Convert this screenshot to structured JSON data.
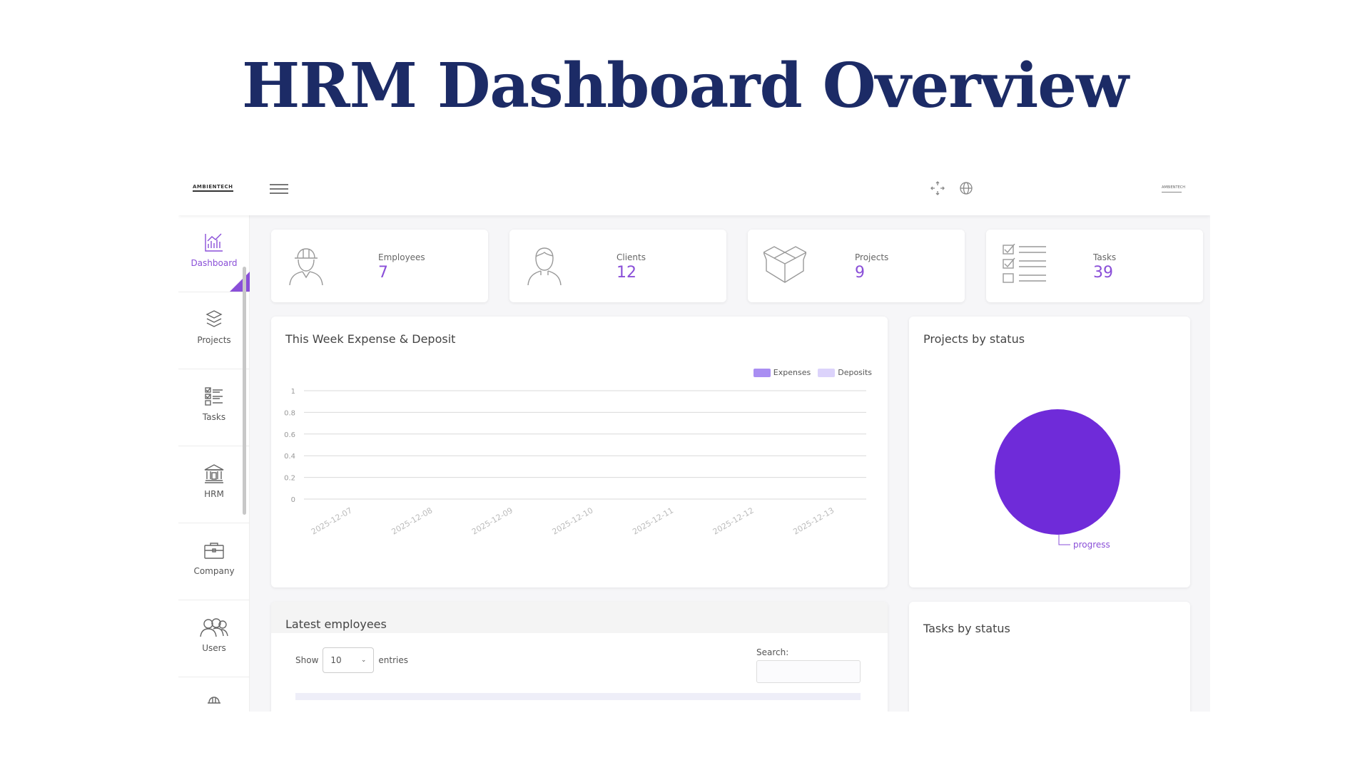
{
  "page": {
    "title": "HRM Dashboard Overview"
  },
  "topbar": {
    "logo": "AMBIENTECH",
    "avatar_text": "AMBIENTECH"
  },
  "sidebar": {
    "items": [
      {
        "label": "Dashboard",
        "icon": "chart-icon",
        "active": true
      },
      {
        "label": "Projects",
        "icon": "boxes-icon"
      },
      {
        "label": "Tasks",
        "icon": "checklist-icon"
      },
      {
        "label": "HRM",
        "icon": "bank-icon"
      },
      {
        "label": "Company",
        "icon": "briefcase-icon"
      },
      {
        "label": "Users",
        "icon": "users-icon"
      }
    ]
  },
  "stats": [
    {
      "label": "Employees",
      "value": "7",
      "icon": "worker-icon"
    },
    {
      "label": "Clients",
      "value": "12",
      "icon": "client-icon"
    },
    {
      "label": "Projects",
      "value": "9",
      "icon": "boxes-icon"
    },
    {
      "label": "Tasks",
      "value": "39",
      "icon": "checklist-icon"
    }
  ],
  "expense_card": {
    "title": "This Week Expense & Deposit"
  },
  "projects_card": {
    "title": "Projects by status"
  },
  "tasks_card": {
    "title": "Tasks by status"
  },
  "employees_card": {
    "title": "Latest employees",
    "show_label": "Show",
    "entries_value": "10",
    "entries_label": "entries",
    "search_label": "Search:"
  },
  "colors": {
    "accent": "#8a4fd8",
    "expenses": "#a98ef2",
    "deposits": "#dcd3fb",
    "pie": "#6f2bd9"
  },
  "chart_data": [
    {
      "type": "bar",
      "title": "This Week Expense & Deposit",
      "categories": [
        "2025-12-07",
        "2025-12-08",
        "2025-12-09",
        "2025-12-10",
        "2025-12-11",
        "2025-12-12",
        "2025-12-13"
      ],
      "series": [
        {
          "name": "Expenses",
          "values": [
            0,
            0,
            0,
            0,
            0,
            0,
            0
          ]
        },
        {
          "name": "Deposits",
          "values": [
            0,
            0,
            0,
            0,
            0,
            0,
            0
          ]
        }
      ],
      "ylim": [
        0,
        1
      ],
      "yticks": [
        "0",
        "0.2",
        "0.4",
        "0.6",
        "0.8",
        "1"
      ],
      "grid": true,
      "legend": "top-right"
    },
    {
      "type": "pie",
      "title": "Projects by status",
      "labels": [
        "progress"
      ],
      "values": [
        100
      ]
    }
  ]
}
